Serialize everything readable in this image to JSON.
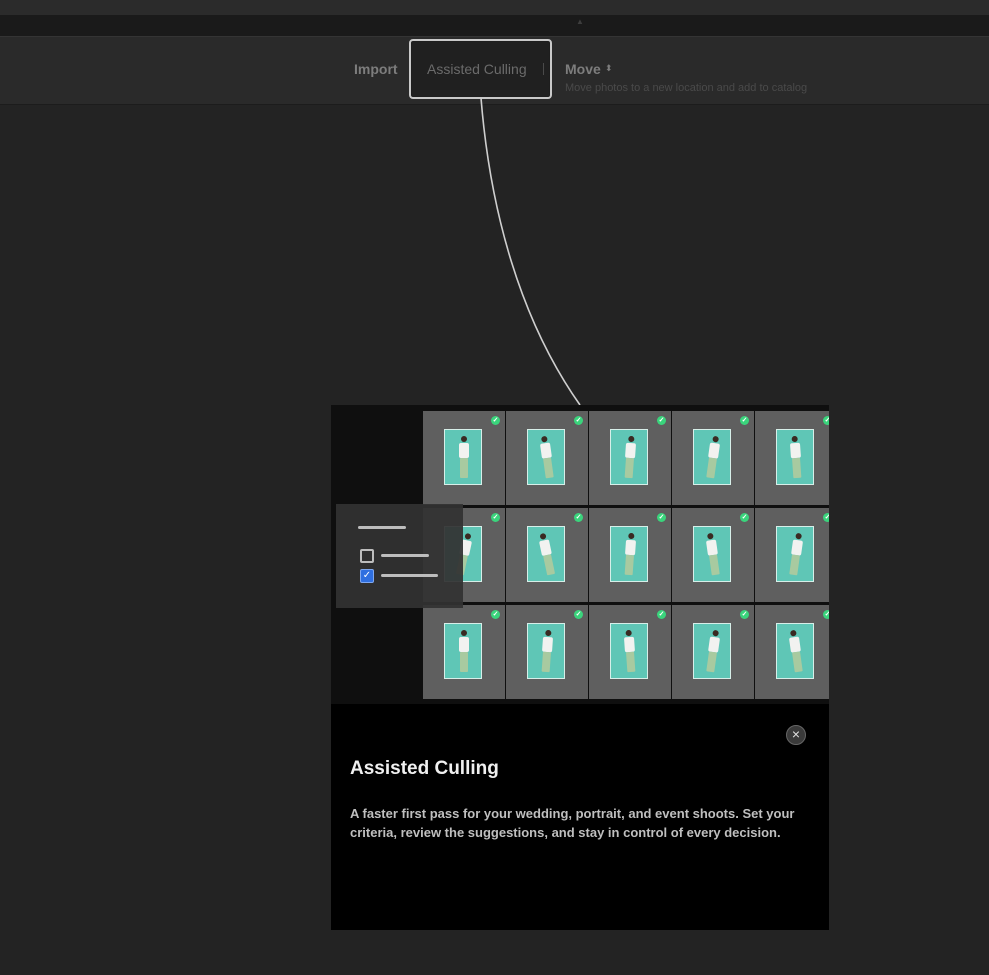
{
  "toolbar": {
    "modes": {
      "import_label": "Import",
      "add_label": "Assisted Culling",
      "move_label": "Move",
      "move_caret": "⬍",
      "move_description": "Move photos to a new location and add to catalog"
    }
  },
  "coachmark": {
    "title": "Assisted Culling",
    "body": "A faster first pass for your wedding, portrait, and event shoots. Set your criteria, review the suggestions, and stay in control of every decision.",
    "close_glyph": "×",
    "media": {
      "thumbnail_rows": 3,
      "thumbnail_columns": 5,
      "all_thumbnails_checked": true,
      "check_glyph": "✓",
      "checkbox_glyph": "✓"
    }
  },
  "colors": {
    "background": "#232323",
    "toolbar": "#2a2a2a",
    "popover": "#000000",
    "highlight_outline": "#c9c9c9",
    "thumb_backdrop": "#5fc6b6",
    "check_green": "#3ad47c",
    "checkbox_blue": "#2f6fe0"
  }
}
